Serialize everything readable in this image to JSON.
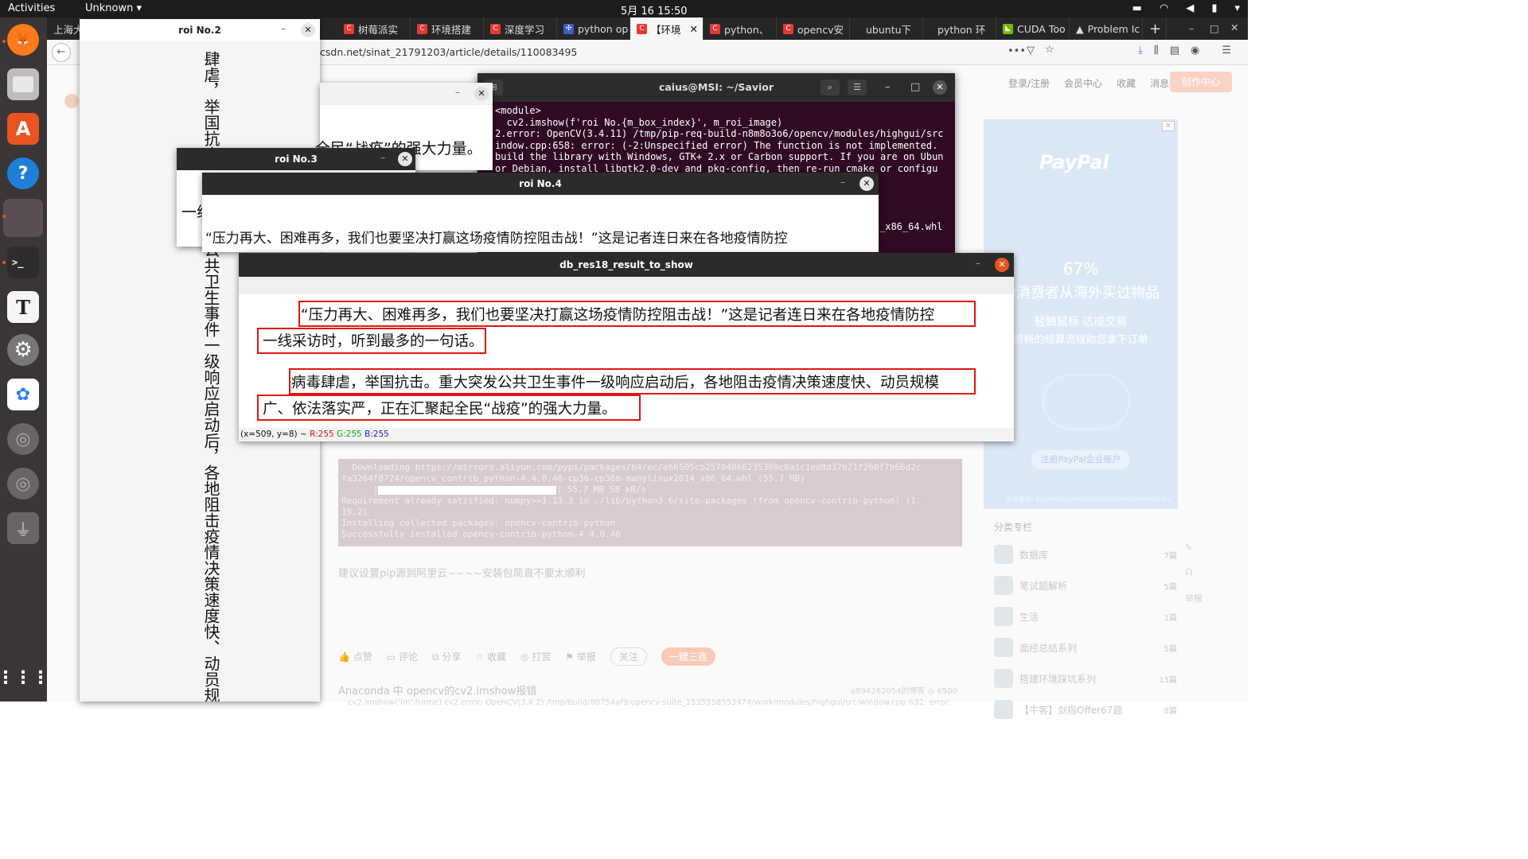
{
  "topbar": {
    "activities": "Activities",
    "app_menu": "Unknown",
    "clock": "5月 16  15:50"
  },
  "dock": {
    "items": [
      "firefox-icon",
      "files-icon",
      "software-icon",
      "help-icon",
      "app-icon",
      "terminal-icon",
      "text-editor-icon",
      "settings-icon",
      "baidu-netdisk-icon",
      "disc-icon",
      "disc-icon",
      "usb-icon",
      "app-grid-icon"
    ]
  },
  "firefox": {
    "first_tab": "上海大",
    "tabs": [
      {
        "label": "树莓派实"
      },
      {
        "label": "环境搭建"
      },
      {
        "label": "深度学习"
      },
      {
        "label": "python op"
      },
      {
        "label": "【环境"
      },
      {
        "label": "python、"
      },
      {
        "label": "opencv安"
      },
      {
        "label": "ubuntu下"
      },
      {
        "label": "python 环"
      },
      {
        "label": "CUDA Too"
      },
      {
        "label": "Problem Ic"
      }
    ],
    "new_tab": "+",
    "url": "csdn.net/sinat_21791203/article/details/110083495"
  },
  "csdn": {
    "header_links": [
      "登录/注册",
      "会员中心",
      "收藏",
      "消息"
    ],
    "create_button": "创作中心",
    "ad": {
      "brand": "PayPal",
      "stat": "67%",
      "stat_text": "的消费者从海外买过物品",
      "tagline": "轻触鼠标 达成交易",
      "tagline2": "顺畅的结算流程助您拿下订单",
      "button": "注册PayPal企业账户",
      "fine_print": "信息来源: baymard.com/lists/cart-abandonment-rate"
    },
    "category_title": "分类专栏",
    "categories": [
      {
        "name": "数据库",
        "count": "7篇"
      },
      {
        "name": "笔试题解析",
        "count": "5篇"
      },
      {
        "name": "生活",
        "count": "1篇"
      },
      {
        "name": "面经总结系列",
        "count": "5篇"
      },
      {
        "name": "搭建环境踩坑系列",
        "count": "13篇"
      },
      {
        "name": "【牛客】剑指Offer67题",
        "count": "8篇"
      }
    ],
    "terminal_lines": [
      "  Downloading https://mirrors.aliyun.com/pypi/packages/b4/ec/a66505cb25704066235369c0a1c1ed8d37b21f260f7b66d2c",
      "fa3264f0724/opencv_contrib_python-4.4.0.46-cp36-cp36m-manylinux2014_x86_64.whl (55.7 MB)",
      "Requirement already satisfied: numpy>=1.13.3 in ./lib/python3.6/site-packages (from opencv-contrib-python) (1.",
      "19.2)",
      "Installing collected packages: opencv-contrib-python",
      "Successfully installed opencv-contrib-python-4.4.0.46"
    ],
    "progress_text": "| 55.7 MB 58 kB/s",
    "download_progress": 1.0,
    "pip_note": "建议设置pip源到阿里云~~~~安装包简直不要太顺利",
    "actions": [
      "点赞",
      "评论",
      "分享",
      "收藏",
      "打赏",
      "举报"
    ],
    "follow": "关注",
    "triple": "一键三连",
    "related_title": "Anaconda 中 opencv的cv2.imshow报错",
    "related_meta": "a894262054的博客  ◎ 6500",
    "related_snip": "cv2.imshow('im',frame) cv2.error: OpenCV(3.4.2) /tmp/build/80754af9/opencv-suite_1535558553474/work/modules/highgui/src/window.cpp:632: error:",
    "side_report": "举报"
  },
  "terminal": {
    "title": "caius@MSI: ~/Savior",
    "lines": [
      "<module>",
      "  cv2.imshow(f'roi No.{m_box_index}', m_roi_image)",
      "2.error: OpenCV(3.4.11) /tmp/pip-req-build-n8m8o3o6/opencv/modules/highgui/src",
      "indow.cpp:658: error: (-2:Unspecified error) The function is not implemented.",
      "build the library with Windows, GTK+ 2.x or Carbon support. If you are on Ubun",
      "or Debian, install libgtk2.0-dev and pkg-config, then re-run cmake or configu"
    ],
    "whl": "_x86_64.whl"
  },
  "roi1": {
    "title": "",
    "text": "全民“战疫”的强大力量。"
  },
  "roi2": {
    "title": "roi No.2",
    "text": "肆虐，举国抗击。重大突发公共卫生事件一级响应启动后，各地阻击疫情决策速度快、动员规模"
  },
  "roi3": {
    "title": "roi No.3",
    "text": "一线"
  },
  "roi4": {
    "title": "roi No.4",
    "text": "“压力再大、困难再多，我们也要坚决打赢这场疫情防控阻击战！”这是记者连日来在各地疫情防控"
  },
  "result": {
    "title": "db_res18_result_to_show",
    "lines": [
      "“压力再大、困难再多，我们也要坚决打赢这场疫情防控阻击战！”这是记者连日来在各地疫情防控",
      "一线采访时，听到最多的一句话。",
      "病毒肆虐，举国抗击。重大突发公共卫生事件一级响应启动后，各地阻击疫情决策速度快、动员规模",
      "广、依法落实严，正在汇聚起全民“战疫”的强大力量。"
    ],
    "status": {
      "coords": "(x=509, y=8) ~",
      "r": "R:255",
      "g": "G:255",
      "b": "B:255"
    }
  }
}
